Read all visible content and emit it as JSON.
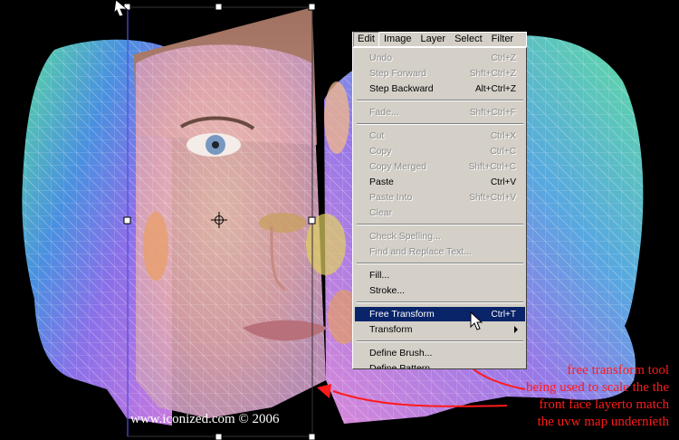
{
  "menubar": {
    "items": [
      "Edit",
      "Image",
      "Layer",
      "Select",
      "Filter"
    ],
    "active_index": 0
  },
  "edit_menu": {
    "items": [
      {
        "label": "Undo",
        "shortcut": "Ctrl+Z",
        "enabled": false
      },
      {
        "label": "Step Forward",
        "shortcut": "Shft+Ctrl+Z",
        "enabled": false
      },
      {
        "label": "Step Backward",
        "shortcut": "Alt+Ctrl+Z",
        "enabled": true
      },
      {
        "label": "Fade...",
        "shortcut": "Shft+Ctrl+F",
        "enabled": false
      },
      {
        "label": "Cut",
        "shortcut": "Ctrl+X",
        "enabled": false
      },
      {
        "label": "Copy",
        "shortcut": "Ctrl+C",
        "enabled": false
      },
      {
        "label": "Copy Merged",
        "shortcut": "Shft+Ctrl+C",
        "enabled": false
      },
      {
        "label": "Paste",
        "shortcut": "Ctrl+V",
        "enabled": true
      },
      {
        "label": "Paste Into",
        "shortcut": "Shft+Ctrl+V",
        "enabled": false
      },
      {
        "label": "Clear",
        "shortcut": "",
        "enabled": false
      },
      {
        "label": "Check Spelling...",
        "shortcut": "",
        "enabled": false
      },
      {
        "label": "Find and Replace Text...",
        "shortcut": "",
        "enabled": false
      },
      {
        "label": "Fill...",
        "shortcut": "",
        "enabled": true
      },
      {
        "label": "Stroke...",
        "shortcut": "",
        "enabled": true
      },
      {
        "label": "Free Transform",
        "shortcut": "Ctrl+T",
        "enabled": true,
        "highlighted": true
      },
      {
        "label": "Transform",
        "shortcut": "",
        "enabled": true,
        "submenu": true
      },
      {
        "label": "Define Brush...",
        "shortcut": "",
        "enabled": true
      },
      {
        "label": "Define Pattern...",
        "shortcut": "",
        "enabled": true
      }
    ]
  },
  "annotation": {
    "lines": [
      "free transform tool",
      "being used to scale the the",
      "front face layerto match",
      "the uvw map underníeth"
    ],
    "color": "#ff1a1a"
  },
  "watermark": "www.iconized.com © 2006",
  "colors": {
    "background": "#000000",
    "menu_bg": "#d4d0c8",
    "highlight": "#0a246a"
  }
}
